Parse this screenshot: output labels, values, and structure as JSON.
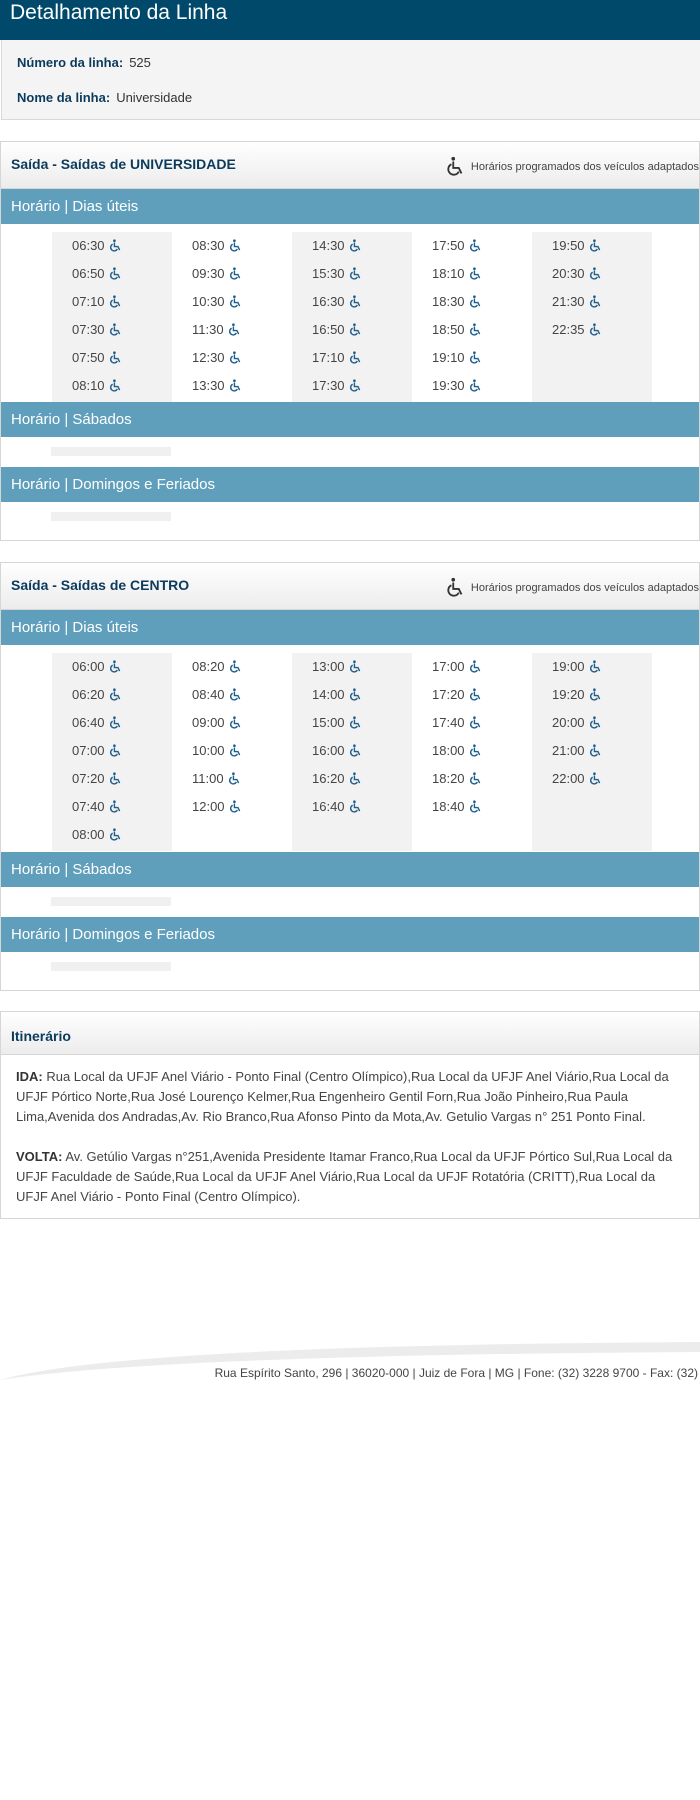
{
  "header": {
    "title": "Detalhamento da Linha"
  },
  "info": {
    "number_label": "Número da linha:",
    "number_value": "525",
    "name_label": "Nome da linha:",
    "name_value": "Universidade"
  },
  "legend_text": "Horários programados dos veículos adaptados",
  "section1": {
    "title": "Saída - Saídas de UNIVERSIDADE",
    "weekday_label": "Horário | Dias úteis",
    "saturday_label": "Horário | Sábados",
    "sunday_label": "Horário | Domingos e Feriados",
    "weekday_times": [
      [
        "06:30",
        "06:50",
        "07:10",
        "07:30",
        "07:50",
        "08:10"
      ],
      [
        "08:30",
        "09:30",
        "10:30",
        "11:30",
        "12:30",
        "13:30"
      ],
      [
        "14:30",
        "15:30",
        "16:30",
        "16:50",
        "17:10",
        "17:30"
      ],
      [
        "17:50",
        "18:10",
        "18:30",
        "18:50",
        "19:10",
        "19:30"
      ],
      [
        "19:50",
        "20:30",
        "21:30",
        "22:35"
      ]
    ]
  },
  "section2": {
    "title": "Saída - Saídas de CENTRO",
    "weekday_label": "Horário | Dias úteis",
    "saturday_label": "Horário | Sábados",
    "sunday_label": "Horário | Domingos e Feriados",
    "weekday_times": [
      [
        "06:00",
        "06:20",
        "06:40",
        "07:00",
        "07:20",
        "07:40",
        "08:00"
      ],
      [
        "08:20",
        "08:40",
        "09:00",
        "10:00",
        "11:00",
        "12:00"
      ],
      [
        "13:00",
        "14:00",
        "15:00",
        "16:00",
        "16:20",
        "16:40"
      ],
      [
        "17:00",
        "17:20",
        "17:40",
        "18:00",
        "18:20",
        "18:40"
      ],
      [
        "19:00",
        "19:20",
        "20:00",
        "21:00",
        "22:00"
      ]
    ]
  },
  "itinerary": {
    "title": "Itinerário",
    "ida_label": "IDA:",
    "ida_text": "Rua Local da UFJF Anel Viário - Ponto Final (Centro Olímpico),Rua Local da UFJF Anel Viário,Rua Local da UFJF Pórtico Norte,Rua José Lourenço Kelmer,Rua Engenheiro Gentil Forn,Rua João Pinheiro,Rua Paula Lima,Avenida dos Andradas,Av. Rio Branco,Rua Afonso Pinto da Mota,Av. Getulio Vargas n° 251 Ponto Final.",
    "volta_label": "VOLTA:",
    "volta_text": "Av. Getúlio Vargas n°251,Avenida Presidente Itamar Franco,Rua Local da UFJF Pórtico Sul,Rua Local da UFJF Faculdade de Saúde,Rua Local da UFJF Anel Viário,Rua Local da UFJF Rotatória (CRITT),Rua Local da UFJF Anel Viário - Ponto Final (Centro Olímpico)."
  },
  "footer": {
    "text": "Rua Espírito Santo, 296 | 36020-000 | Juiz de Fora | MG | Fone: (32) 3228 9700 - Fax: (32)"
  },
  "icons": {
    "accessible": "wheelchair-icon"
  },
  "colors": {
    "header": "#00496b",
    "bar": "#5f9fbb",
    "title": "#0b3b5c",
    "icon": "#1f5f8b"
  }
}
